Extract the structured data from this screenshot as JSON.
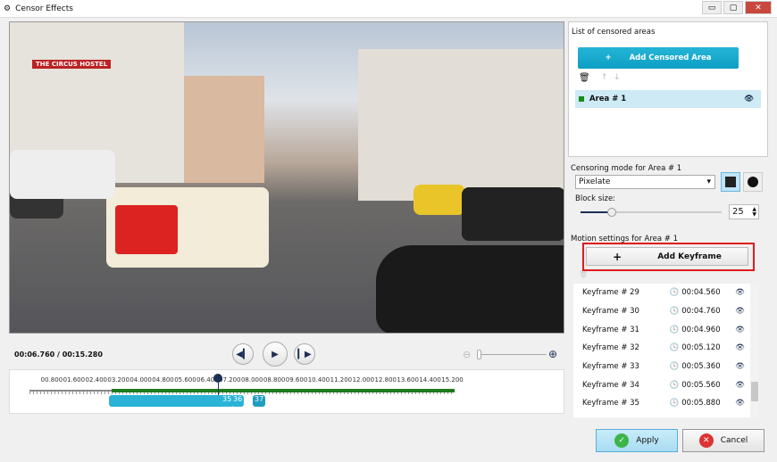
{
  "window": {
    "title": "Censor Effects",
    "controls": [
      "▭",
      "▢",
      "✕"
    ]
  },
  "player": {
    "time": "00:06.760 / 00:15.280",
    "ticks": [
      "00.800",
      "01.600",
      "02.400",
      "03.200",
      "04.000",
      "04.800",
      "05.600",
      "06.400",
      "07.200",
      "08.000",
      "08.800",
      "09.600",
      "10.400",
      "11.200",
      "12.000",
      "12.800",
      "13.600",
      "14.400",
      "15.200"
    ],
    "duration_s": 15.28,
    "position_s": 6.76,
    "keyframe_markers": [
      "35",
      "36",
      "37"
    ]
  },
  "video": {
    "sign": "THE CIRCUS HOSTEL"
  },
  "areas": {
    "title": "List of censored areas",
    "add_label": "Add Censored Area",
    "items": [
      {
        "name": "Area # 1",
        "color": "#1a8a1a"
      }
    ]
  },
  "mode": {
    "title": "Censoring mode for Area # 1",
    "value": "Pixelate",
    "block_label": "Block size:",
    "block_size": "25",
    "slider_fraction": 0.22
  },
  "motion": {
    "title": "Motion settings for Area # 1",
    "add_label": "Add Keyframe",
    "keyframes": [
      {
        "name": "Keyframe # 29",
        "time": "00:04.560"
      },
      {
        "name": "Keyframe # 30",
        "time": "00:04.760"
      },
      {
        "name": "Keyframe # 31",
        "time": "00:04.960"
      },
      {
        "name": "Keyframe # 32",
        "time": "00:05.120"
      },
      {
        "name": "Keyframe # 33",
        "time": "00:05.360"
      },
      {
        "name": "Keyframe # 34",
        "time": "00:05.560"
      },
      {
        "name": "Keyframe # 35",
        "time": "00:05.880"
      }
    ]
  },
  "footer": {
    "apply": "Apply",
    "cancel": "Cancel"
  },
  "colors": {
    "accent": "#14a8cc",
    "track": "#1e7a1e",
    "highlight": "#e01b1b"
  }
}
